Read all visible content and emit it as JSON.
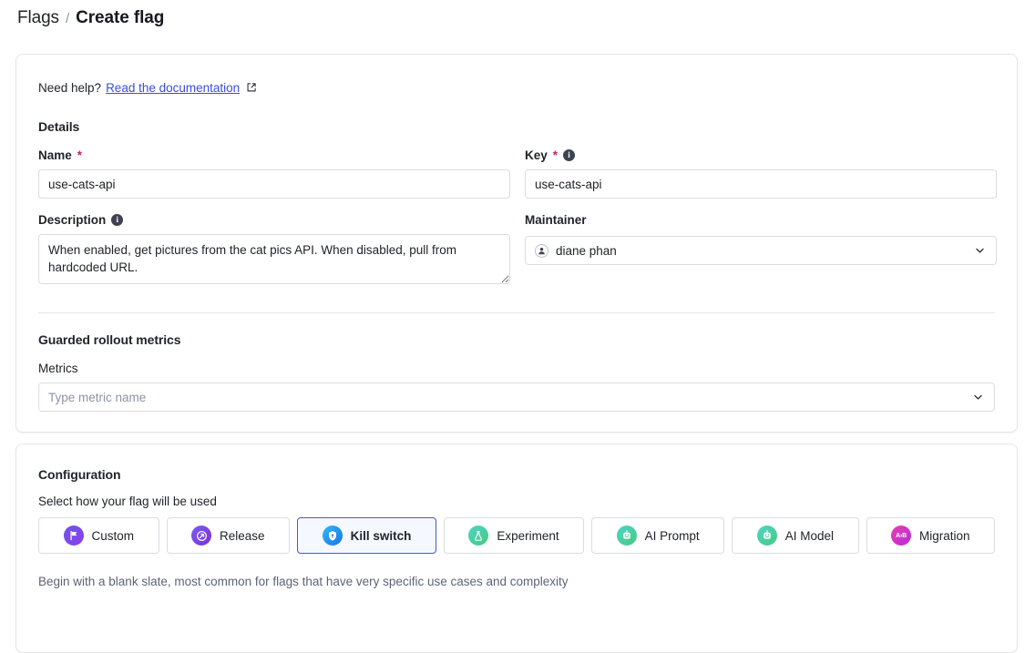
{
  "breadcrumb": {
    "root": "Flags",
    "separator": "/",
    "current": "Create flag"
  },
  "help": {
    "label": "Need help?",
    "link_text": "Read the documentation",
    "external_icon": "external-link-icon"
  },
  "details": {
    "title": "Details",
    "name": {
      "label": "Name",
      "required_marker": "*",
      "value": "use-cats-api"
    },
    "key": {
      "label": "Key",
      "required_marker": "*",
      "value": "use-cats-api",
      "info_icon": "info-icon",
      "info_glyph": "i"
    },
    "description": {
      "label": "Description",
      "value": "When enabled, get pictures from the cat pics API. When disabled, pull from hardcoded URL.",
      "info_icon": "info-icon",
      "info_glyph": "i"
    },
    "maintainer": {
      "label": "Maintainer",
      "value": "diane phan",
      "avatar_icon": "person-avatar-icon",
      "chevron_icon": "chevron-down-icon"
    }
  },
  "metrics_section": {
    "title": "Guarded rollout metrics",
    "metrics": {
      "label": "Metrics",
      "value": "",
      "placeholder": "Type metric name",
      "chevron_icon": "chevron-down-icon"
    }
  },
  "configuration": {
    "title": "Configuration",
    "subtitle": "Select how your flag will be used",
    "selected_type": "Kill switch",
    "flag_types": [
      {
        "label": "Custom",
        "icon": "flag-icon",
        "icon_class": "ic-custom",
        "selected": false
      },
      {
        "label": "Release",
        "icon": "rocket-arrow-icon",
        "icon_class": "ic-release",
        "selected": false
      },
      {
        "label": "Kill switch",
        "icon": "shield-icon",
        "icon_class": "ic-killswitch",
        "selected": true
      },
      {
        "label": "Experiment",
        "icon": "flask-icon",
        "icon_class": "ic-experiment",
        "selected": false
      },
      {
        "label": "AI Prompt",
        "icon": "robot-icon",
        "icon_class": "ic-aiprompt",
        "selected": false
      },
      {
        "label": "AI Model",
        "icon": "robot-icon",
        "icon_class": "ic-aimodel",
        "selected": false
      },
      {
        "label": "Migration",
        "icon": "a-to-b-icon",
        "icon_class": "ic-migration",
        "selected": false,
        "icon_text": "A›B"
      }
    ],
    "helper_text": "Begin with a blank slate, most common for flags that have very specific use cases and complexity"
  },
  "colors": {
    "accent_blue": "#3b5bdb",
    "link_blue": "#3b4ce2",
    "required_red": "#cc1e6c",
    "border": "#d9dce2",
    "card_border": "#e3e5e9",
    "text": "#21242b",
    "muted_text": "#8c94a5"
  }
}
